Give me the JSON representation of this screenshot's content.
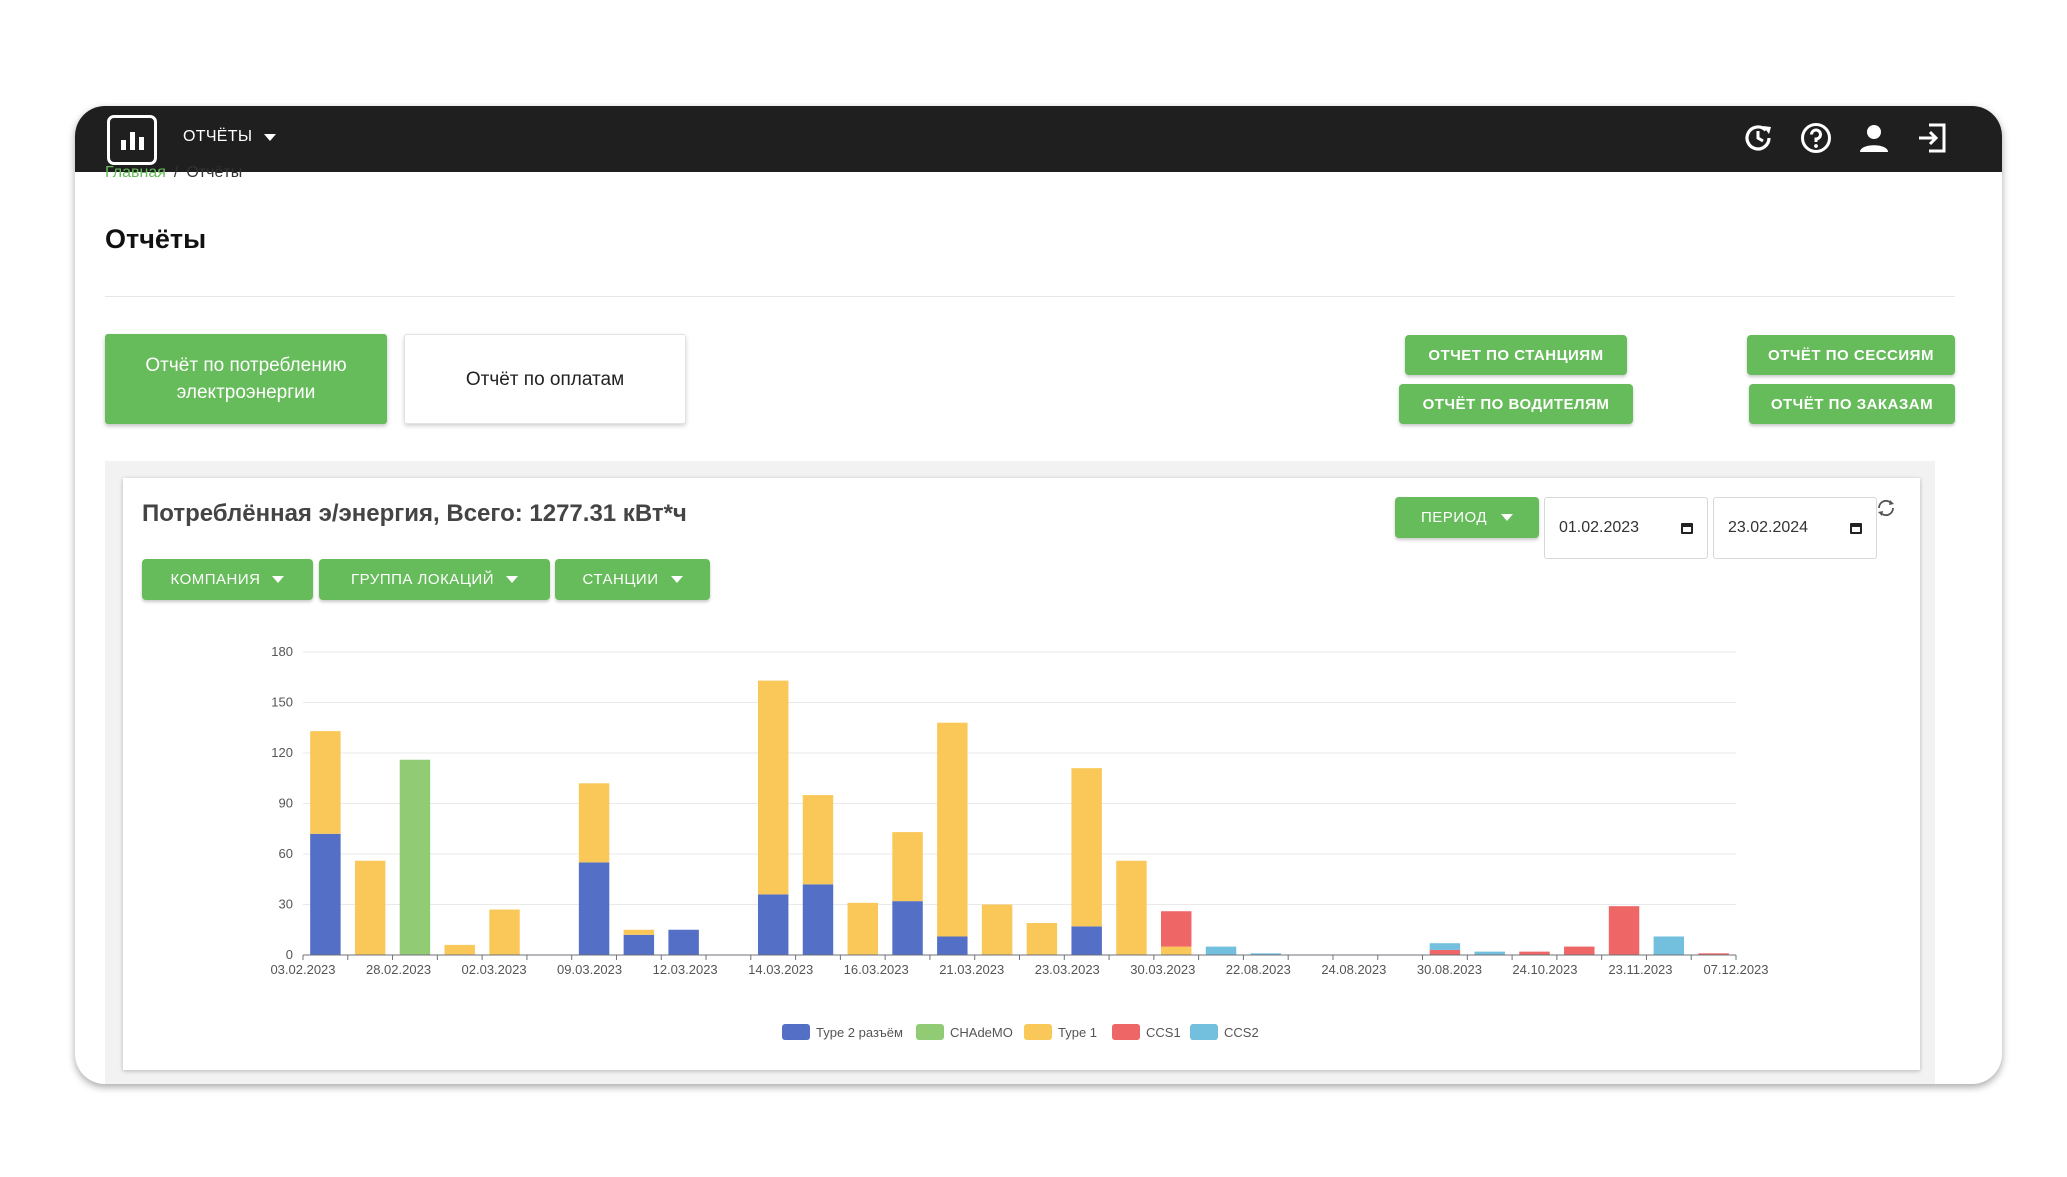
{
  "header": {
    "menu_label": "ОТЧЁТЫ",
    "icons": [
      "history-icon",
      "help-icon",
      "user-icon",
      "logout-icon"
    ]
  },
  "breadcrumb": {
    "home": "Главная",
    "separator": "/",
    "current": "Отчёты"
  },
  "page": {
    "title": "Отчёты"
  },
  "report_tabs": {
    "consumption": "Отчёт по потреблению электроэнергии",
    "payments": "Отчёт по оплатам"
  },
  "report_links": {
    "stations": "ОТЧЕТ ПО СТАНЦИЯМ",
    "drivers": "ОТЧЁТ ПО ВОДИТЕЛЯМ",
    "sessions": "ОТЧЁТ ПО СЕССИЯМ",
    "orders": "ОТЧЁТ ПО ЗАКАЗАМ"
  },
  "panel": {
    "title": "Потреблённая э/энергия, Всего: 1277.31 кВт*ч",
    "filters": {
      "company": "КОМПАНИЯ",
      "location_group": "ГРУППА ЛОКАЦИЙ",
      "stations": "СТАНЦИИ"
    },
    "period_label": "ПЕРИОД",
    "date_from": "01.02.2023",
    "date_to": "23.02.2024"
  },
  "colors": {
    "accent": "#66bb5a",
    "topbar": "#1f1f1f",
    "type2": "#5470c6",
    "chademo": "#91cc75",
    "type1": "#fac858",
    "ccs1": "#ee6666",
    "ccs2": "#73c0de"
  },
  "chart_data": {
    "type": "bar",
    "stacked": true,
    "x_tick_labels": [
      "03.02.2023",
      "28.02.2023",
      "02.03.2023",
      "09.03.2023",
      "12.03.2023",
      "14.03.2023",
      "16.03.2023",
      "21.03.2023",
      "23.03.2023",
      "30.03.2023",
      "22.08.2023",
      "24.08.2023",
      "30.08.2023",
      "24.10.2023",
      "23.11.2023",
      "07.12.2023"
    ],
    "ylim": [
      0,
      180
    ],
    "yticks": [
      0,
      30,
      60,
      90,
      120,
      150,
      180
    ],
    "grid": true,
    "legend_position": "bottom-center",
    "series": [
      {
        "name": "Type 2 разъём",
        "color": "#5470c6",
        "values": [
          72,
          0,
          0,
          0,
          0,
          0,
          55,
          12,
          15,
          0,
          36,
          42,
          0,
          32,
          11,
          0,
          0,
          17,
          0,
          0,
          0,
          0,
          0,
          0,
          0,
          0,
          0,
          0,
          0,
          0,
          0,
          0
        ]
      },
      {
        "name": "CHAdeMO",
        "color": "#91cc75",
        "values": [
          0,
          0,
          116,
          0,
          0,
          0,
          0,
          0,
          0,
          0,
          0,
          0,
          0,
          0,
          0,
          0,
          0,
          0,
          0,
          0,
          0,
          0,
          0,
          0,
          0,
          0,
          0,
          0,
          0,
          0,
          0,
          0
        ]
      },
      {
        "name": "Type 1",
        "color": "#fac858",
        "values": [
          61,
          56,
          0,
          6,
          27,
          0,
          47,
          3,
          0,
          0,
          127,
          53,
          31,
          41,
          127,
          30,
          19,
          94,
          56,
          5,
          0,
          0,
          0,
          0,
          0,
          0,
          0,
          0,
          0,
          0,
          0,
          0
        ]
      },
      {
        "name": "CCS1",
        "color": "#ee6666",
        "values": [
          0,
          0,
          0,
          0,
          0,
          0,
          0,
          0,
          0,
          0,
          0,
          0,
          0,
          0,
          0,
          0,
          0,
          0,
          0,
          21,
          0,
          0,
          0,
          0,
          0,
          3,
          0,
          2,
          5,
          29,
          0,
          1
        ]
      },
      {
        "name": "CCS2",
        "color": "#73c0de",
        "values": [
          0,
          0,
          0,
          0,
          0,
          0,
          0,
          0,
          0,
          0,
          0,
          0,
          0,
          0,
          0,
          0,
          0,
          0,
          0,
          0,
          5,
          1,
          0,
          0,
          0,
          4,
          2,
          0,
          0,
          0,
          11,
          0
        ]
      }
    ]
  }
}
